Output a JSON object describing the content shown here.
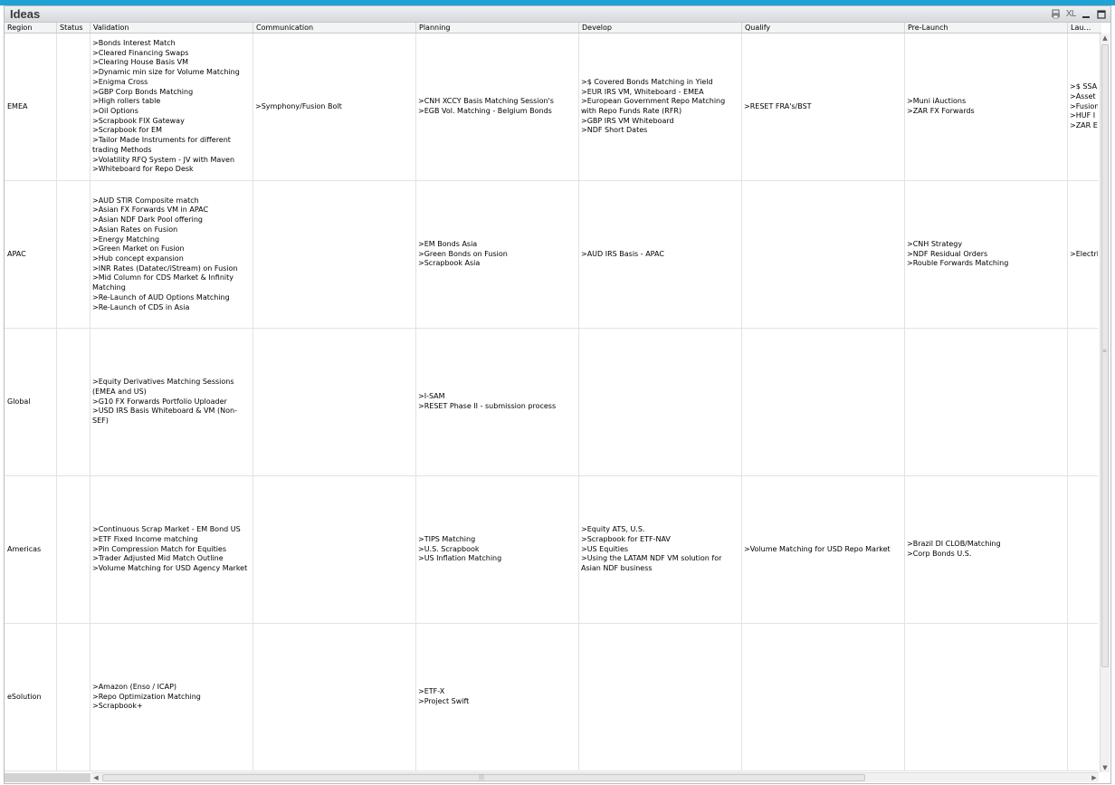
{
  "window": {
    "title": "Ideas",
    "icons": [
      "print-icon",
      "xl-export-icon",
      "minimize-icon",
      "maximize-icon"
    ],
    "xl_label": "XL",
    "colors": {
      "accent_strip": "#1fa3d6",
      "header_bg": "#f3f4f5",
      "grid_line": "#e2e2e2"
    }
  },
  "columns": [
    "Region",
    "Status",
    "Validation",
    "Communication",
    "Planning",
    "Develop",
    "Qualify",
    "Pre-Launch",
    "Lau…"
  ],
  "rows": [
    {
      "region": "EMEA",
      "status": "",
      "validation": [
        ">Bonds Interest Match",
        ">Cleared Financing Swaps",
        ">Clearing House Basis VM",
        ">Dynamic min size for Volume Matching",
        ">Enigma Cross",
        ">GBP Corp Bonds Matching",
        ">High rollers table",
        ">Oil Options",
        ">Scrapbook FIX Gateway",
        ">Scrapbook for EM",
        ">Tailor Made Instruments for different trading Methods",
        ">Volatility RFQ System - JV with Maven",
        ">Whiteboard for Repo Desk"
      ],
      "communication": [
        ">Symphony/Fusion Bolt"
      ],
      "planning": [
        ">CNH XCCY Basis Matching Session's",
        ">EGB Vol. Matching - Belgium Bonds"
      ],
      "develop": [
        ">$ Covered Bonds Matching in Yield",
        ">EUR IRS VM, Whiteboard - EMEA",
        ">European Government Repo Matching with Repo Funds Rate (RFR)",
        ">GBP IRS VM Whiteboard",
        ">NDF Short Dates"
      ],
      "qualify": [
        ">RESET FRA's/BST"
      ],
      "prelaunch": [
        ">Muni iAuctions",
        ">ZAR FX Forwards"
      ],
      "launch": [
        ">$ SSA",
        ">Asset",
        ">Fusion",
        ">HUF I",
        ">ZAR E"
      ]
    },
    {
      "region": "APAC",
      "status": "",
      "validation": [
        ">AUD STIR Composite match",
        ">Asian FX Forwards VM in APAC",
        ">Asian NDF Dark Pool offering",
        ">Asian Rates on Fusion",
        ">Energy Matching",
        ">Green Market on Fusion",
        ">Hub concept expansion",
        ">INR Rates (Datatec/iStream) on Fusion",
        ">Mid Column for CDS Market & Infinity Matching",
        ">Re-Launch of AUD Options Matching",
        ">Re-Launch of CDS in Asia"
      ],
      "communication": [],
      "planning": [
        ">EM Bonds Asia",
        ">Green Bonds on Fusion",
        ">Scrapbook Asia"
      ],
      "develop": [
        ">AUD IRS Basis - APAC"
      ],
      "qualify": [],
      "prelaunch": [
        ">CNH Strategy",
        ">NDF Residual Orders",
        ">Rouble Forwards Matching"
      ],
      "launch": [
        ">Electri"
      ]
    },
    {
      "region": "Global",
      "status": "",
      "validation": [
        ">Equity Derivatives Matching Sessions (EMEA and US)",
        ">G10 FX Forwards Portfolio Uploader",
        ">USD IRS Basis Whiteboard & VM (Non-SEF)"
      ],
      "communication": [],
      "planning": [
        ">I-SAM",
        ">RESET Phase II - submission process"
      ],
      "develop": [],
      "qualify": [],
      "prelaunch": [],
      "launch": []
    },
    {
      "region": "Americas",
      "status": "",
      "validation": [
        ">Continuous Scrap Market - EM Bond US",
        ">ETF Fixed Income matching",
        ">Pin Compression Match for Equities",
        ">Trader Adjusted Mid Match Outline",
        ">Volume Matching for USD Agency Market"
      ],
      "communication": [],
      "planning": [
        ">TIPS Matching",
        ">U.S. Scrapbook",
        ">US Inflation Matching"
      ],
      "develop": [
        ">Equity ATS, U.S.",
        ">Scrapbook for ETF-NAV",
        ">US Equities",
        ">Using the LATAM NDF VM solution for Asian NDF business"
      ],
      "qualify": [
        ">Volume Matching for USD Repo Market"
      ],
      "prelaunch": [
        ">Brazil DI CLOB/Matching",
        ">Corp Bonds U.S."
      ],
      "launch": []
    },
    {
      "region": "eSolution",
      "status": "",
      "validation": [
        ">Amazon (Enso / ICAP)",
        ">Repo Optimization Matching",
        ">Scrapbook+"
      ],
      "communication": [],
      "planning": [
        ">ETF-X",
        ">Project  Swift"
      ],
      "develop": [],
      "qualify": [],
      "prelaunch": [],
      "launch": []
    }
  ],
  "scrollbars": {
    "vertical": "vertical-scrollbar",
    "horizontal": "horizontal-scrollbar"
  }
}
